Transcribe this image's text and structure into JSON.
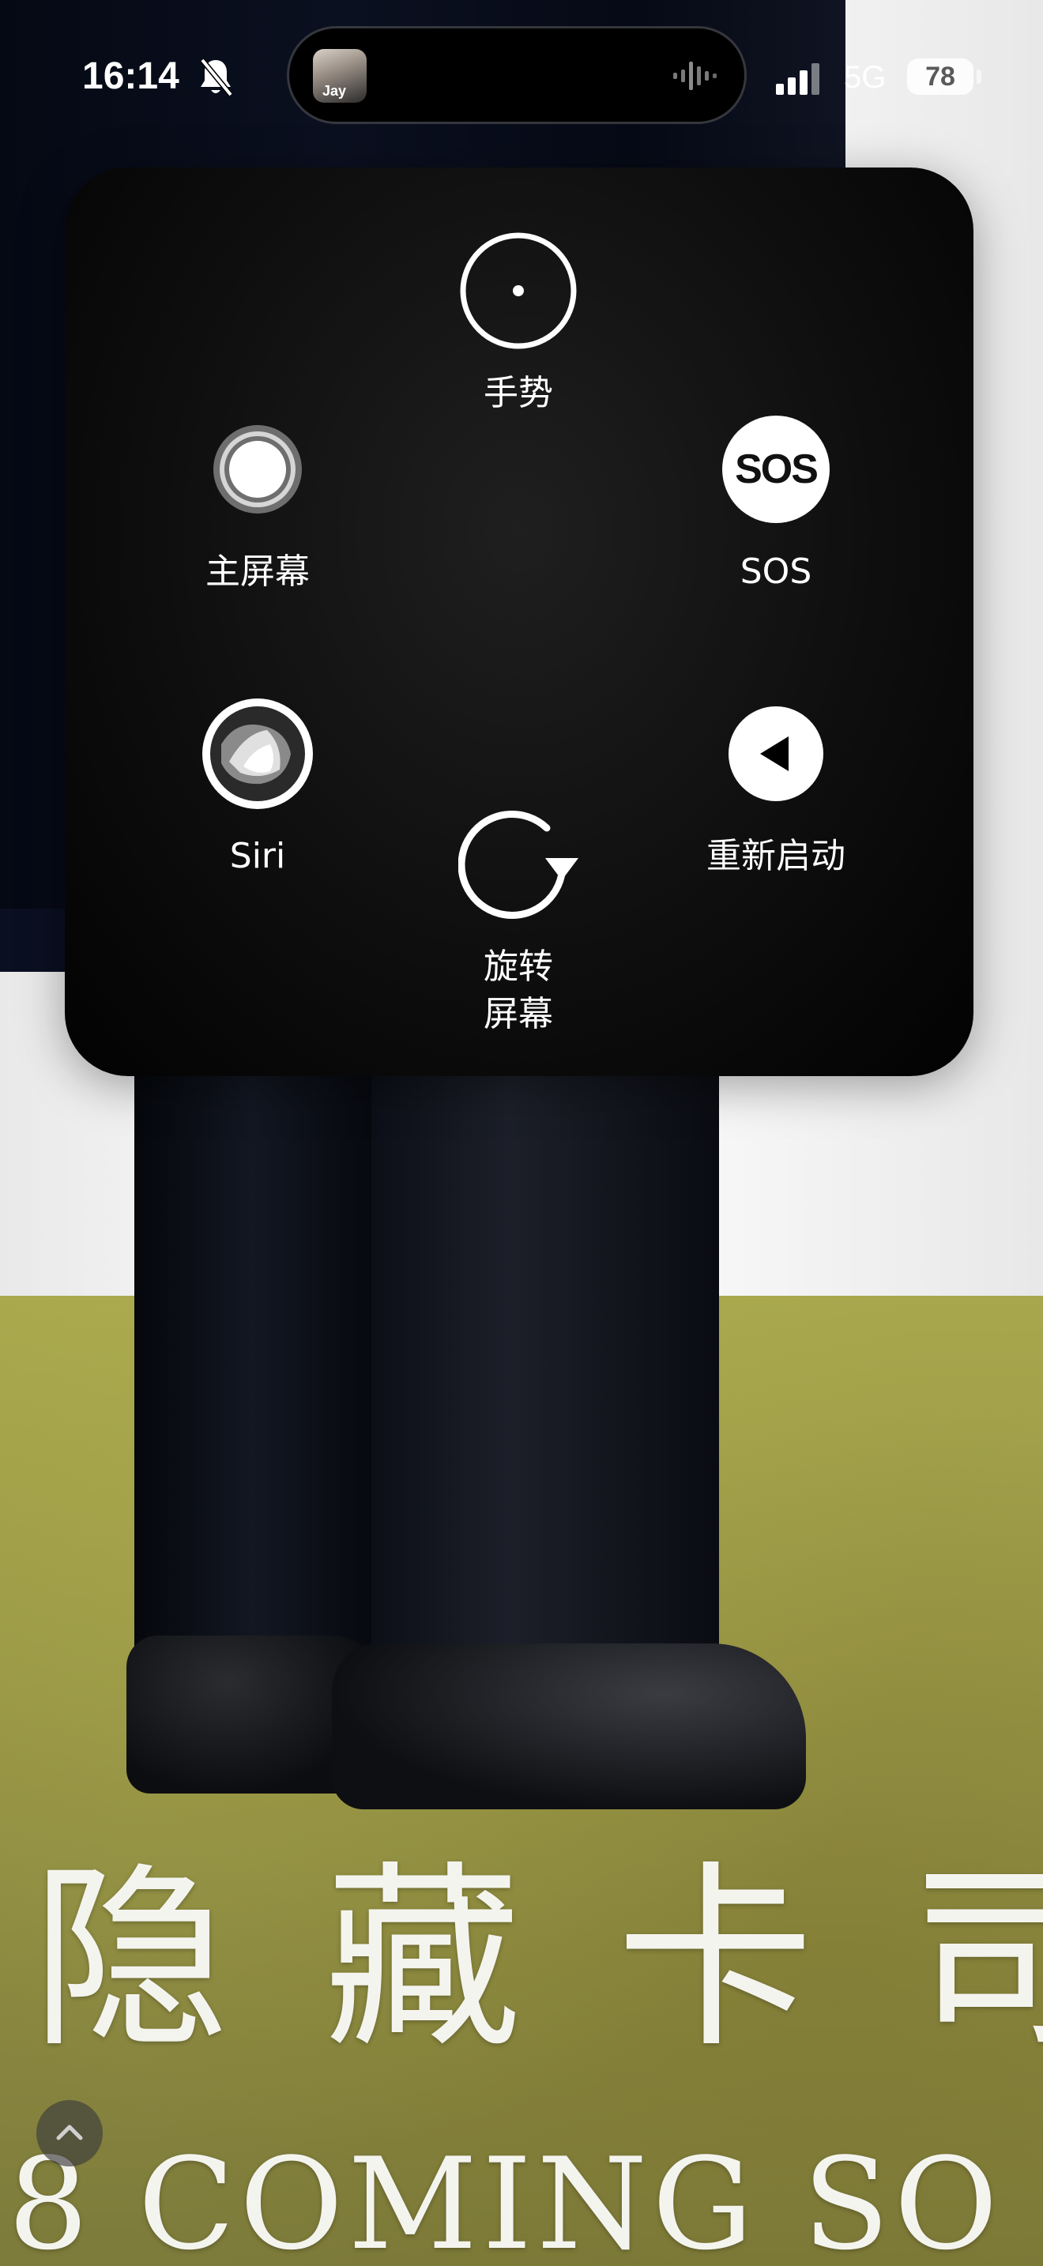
{
  "status_bar": {
    "time": "16:14",
    "network": "5G",
    "battery": "78",
    "album_art_text": "Jay"
  },
  "assistive_touch": {
    "items": [
      {
        "label": "手势",
        "icon": "gesture-icon"
      },
      {
        "label": "主屏幕",
        "icon": "home-icon"
      },
      {
        "label": "SOS",
        "icon": "sos-icon",
        "icon_text": "SOS"
      },
      {
        "label": "Siri",
        "icon": "siri-icon"
      },
      {
        "label": "重新启动",
        "icon": "restart-icon"
      },
      {
        "label_line1": "旋转",
        "label_line2": "屏幕",
        "icon": "rotate-screen-icon"
      }
    ]
  },
  "wallpaper": {
    "title": "隐藏卡司",
    "subtitle": "8 COMING SO"
  },
  "colors": {
    "menu_bg": "#0d0d0d",
    "label": "#ffffff",
    "grass": "#9a9846",
    "coat": "#0b1020"
  }
}
